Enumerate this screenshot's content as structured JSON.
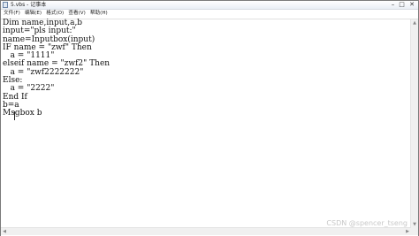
{
  "window": {
    "title": "5.vbs - 记事本",
    "minimize_glyph": "–",
    "maximize_glyph": "□",
    "close_glyph": "✕"
  },
  "menu": {
    "items": [
      "文件(F)",
      "编辑(E)",
      "格式(O)",
      "查看(V)",
      "帮助(H)"
    ]
  },
  "editor": {
    "content": "Dim name,input,a,b\ninput=\"pls input:\"\nname=Inputbox(input)\nIF name = \"zwf\" Then\n   a = \"1111\"\nelseif name = \"zwf2\" Then\n   a = \"zwf2222222\"\nElse:\n   a = \"2222\"\nEnd If\nb=a\nMsgbox b"
  },
  "watermark": "CSDN @spencer_tseng",
  "scrollbar": {
    "up_glyph": "▲",
    "down_glyph": "▼",
    "left_glyph": "◀",
    "right_glyph": "▶"
  }
}
